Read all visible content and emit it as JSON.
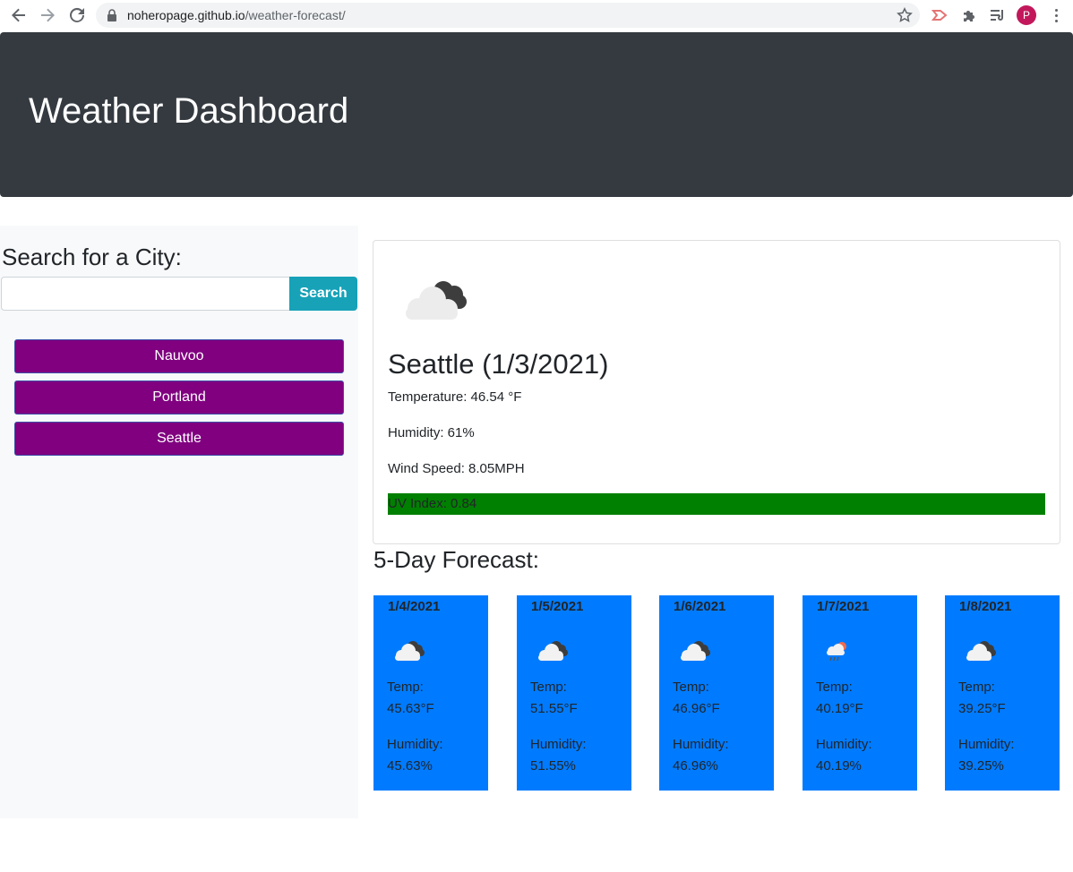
{
  "browser": {
    "url_host": "noheropage.github.io",
    "url_path": "/weather-forecast/",
    "profile_initial": "P"
  },
  "header": {
    "title": "Weather Dashboard"
  },
  "sidebar": {
    "search_heading": "Search for a City:",
    "search_placeholder": "",
    "search_button": "Search",
    "cities": [
      "Nauvoo",
      "Portland",
      "Seattle"
    ]
  },
  "current": {
    "icon": "cloudy-icon",
    "title": "Seattle (1/3/2021)",
    "temperature": "Temperature: 46.54 °F",
    "humidity": "Humidity: 61%",
    "wind": "Wind Speed: 8.05MPH",
    "uv": "UV Index: 0.84",
    "uv_color": "#008000"
  },
  "forecast": {
    "heading": "5-Day Forecast:",
    "card_color": "#007bff",
    "days": [
      {
        "date": "1/4/2021",
        "icon": "cloudy-icon",
        "temp_label": "Temp:",
        "temp": "45.63°F",
        "humidity_label": "Humidity:",
        "humidity": "45.63%"
      },
      {
        "date": "1/5/2021",
        "icon": "cloudy-icon",
        "temp_label": "Temp:",
        "temp": "51.55°F",
        "humidity_label": "Humidity:",
        "humidity": "51.55%"
      },
      {
        "date": "1/6/2021",
        "icon": "cloudy-icon",
        "temp_label": "Temp:",
        "temp": "46.96°F",
        "humidity_label": "Humidity:",
        "humidity": "46.96%"
      },
      {
        "date": "1/7/2021",
        "icon": "rain-icon",
        "temp_label": "Temp:",
        "temp": "40.19°F",
        "humidity_label": "Humidity:",
        "humidity": "40.19%"
      },
      {
        "date": "1/8/2021",
        "icon": "cloudy-icon",
        "temp_label": "Temp:",
        "temp": "39.25°F",
        "humidity_label": "Humidity:",
        "humidity": "39.25%"
      }
    ]
  }
}
